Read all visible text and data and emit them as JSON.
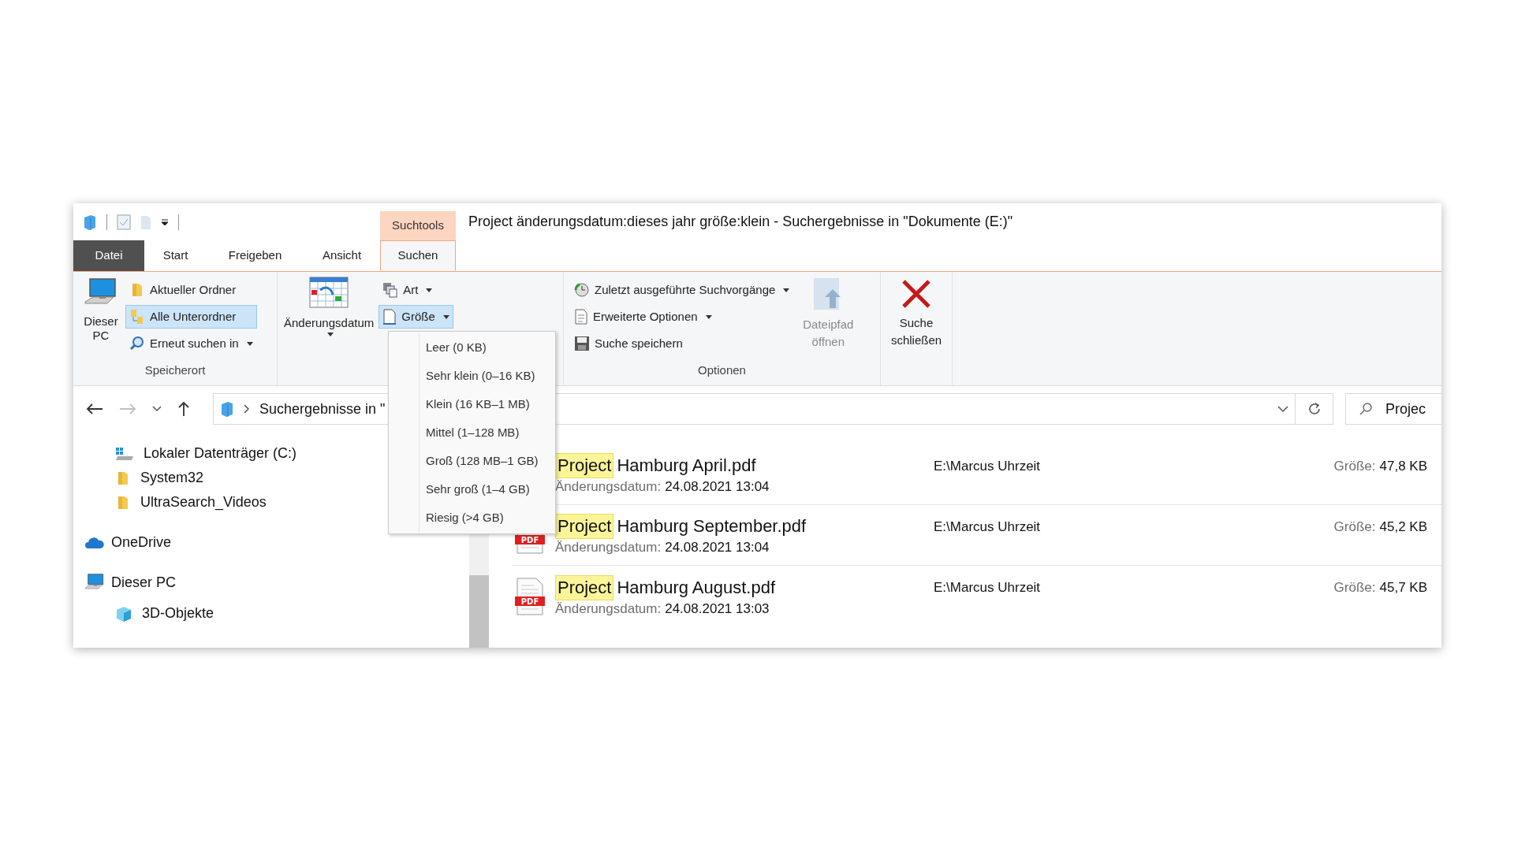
{
  "window": {
    "title": "Project änderungsdatum:dieses jahr größe:klein - Suchergebnisse in \"Dokumente (E:)\""
  },
  "context_tab_group": {
    "label": "Suchtools"
  },
  "tabs": [
    {
      "label": "Datei",
      "kind": "file",
      "selected": false
    },
    {
      "label": "Start",
      "kind": "tab",
      "selected": false
    },
    {
      "label": "Freigeben",
      "kind": "tab",
      "selected": false
    },
    {
      "label": "Ansicht",
      "kind": "tab",
      "selected": false
    },
    {
      "label": "Suchen",
      "kind": "tab",
      "selected": true
    }
  ],
  "ribbon": {
    "location_group": {
      "label": "Speicherort",
      "big_button": "Dieser PC",
      "items": [
        {
          "label": "Aktueller Ordner",
          "selected": false,
          "dropdown": false
        },
        {
          "label": "Alle Unterordner",
          "selected": true,
          "dropdown": false
        },
        {
          "label": "Erneut suchen in",
          "selected": false,
          "dropdown": true
        }
      ]
    },
    "refine_group": {
      "date_button": "Änderungsdatum",
      "items": [
        {
          "label": "Art",
          "selected": false
        },
        {
          "label": "Größe",
          "selected": true
        }
      ]
    },
    "options_group": {
      "label": "Optionen",
      "items": [
        {
          "label": "Zuletzt ausgeführte Suchvorgänge",
          "dropdown": true
        },
        {
          "label": "Erweiterte Optionen",
          "dropdown": true
        },
        {
          "label": "Suche speichern",
          "dropdown": false
        }
      ],
      "path_button": {
        "label": "Dateipfad öffnen",
        "disabled": true
      }
    },
    "close_button": {
      "label": "Suche schließen"
    }
  },
  "size_menu": {
    "items": [
      {
        "label": "Leer (0 KB)"
      },
      {
        "label": "Sehr klein (0–16 KB)"
      },
      {
        "label": "Klein (16 KB–1 MB)"
      },
      {
        "label": "Mittel (1–128 MB)"
      },
      {
        "label": "Groß (128 MB–1 GB)"
      },
      {
        "label": "Sehr groß (1–4 GB)"
      },
      {
        "label": "Riesig (>4 GB)"
      }
    ]
  },
  "address": {
    "path": "Suchergebnisse in \""
  },
  "search": {
    "value": "Projec"
  },
  "nav": {
    "continued_items": [
      {
        "label": "Lokaler Datenträger (C:)"
      },
      {
        "label": "System32"
      },
      {
        "label": "UltraSearch_Videos"
      }
    ],
    "items": [
      {
        "label": "OneDrive"
      },
      {
        "label": "Dieser PC",
        "children": [
          {
            "label": "3D-Objekte"
          }
        ]
      }
    ]
  },
  "files": [
    {
      "match": "Project",
      "rest": "Hamburg April.pdf",
      "date_label": "Änderungsdatum:",
      "date": "24.08.2021 13:04",
      "path": "E:\\Marcus Uhrzeit",
      "size_label": "Größe:",
      "size": "47,8 KB"
    },
    {
      "match": "Project",
      "rest": "Hamburg September.pdf",
      "icon_label": "PDF",
      "date_label": "Änderungsdatum:",
      "date": "24.08.2021 13:04",
      "path": "E:\\Marcus Uhrzeit",
      "size_label": "Größe:",
      "size": "45,2 KB"
    },
    {
      "match": "Project",
      "rest": "Hamburg August.pdf",
      "icon_label": "PDF",
      "date_label": "Änderungsdatum:",
      "date": "24.08.2021 13:03",
      "path": "E:\\Marcus Uhrzeit",
      "size_label": "Größe:",
      "size": "45,7 KB"
    }
  ]
}
